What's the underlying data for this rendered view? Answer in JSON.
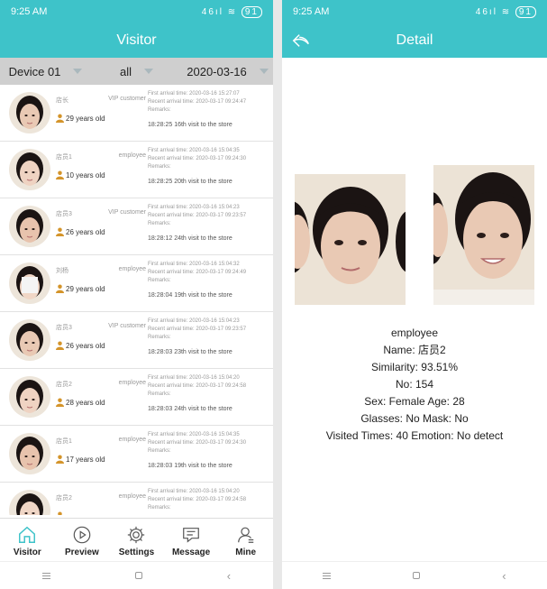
{
  "status": {
    "time": "9:25 AM",
    "signal": "46ıl",
    "battery": "91"
  },
  "left": {
    "title": "Visitor",
    "filters": {
      "device": "Device 01",
      "type": "all",
      "date": "2020-03-16"
    },
    "visitors": [
      {
        "name": "店长",
        "type": "VIP customer",
        "age": "29 years old",
        "first": "First arrival time: 2020-03-16 15:27:07",
        "recent": "Recent arrival time: 2020-03-17 09:24:47",
        "remarks": "Remarks:",
        "visit": "18:28:25 16th visit to the store"
      },
      {
        "name": "店员1",
        "type": "employee",
        "age": "10 years old",
        "first": "First arrival time: 2020-03-16 15:04:35",
        "recent": "Recent arrival time: 2020-03-17 09:24:30",
        "remarks": "Remarks:",
        "visit": "18:28:25 20th visit to the store"
      },
      {
        "name": "店员3",
        "type": "VIP customer",
        "age": "26 years old",
        "first": "First arrival time: 2020-03-16 15:04:23",
        "recent": "Recent arrival time: 2020-03-17 09:23:57",
        "remarks": "Remarks:",
        "visit": "18:28:12 24th visit to the store"
      },
      {
        "name": "刘杨",
        "type": "employee",
        "age": "29 years old",
        "first": "First arrival time: 2020-03-16 15:04:32",
        "recent": "Recent arrival time: 2020-03-17 09:24:49",
        "remarks": "Remarks:",
        "visit": "18:28:04 19th visit to the store"
      },
      {
        "name": "店员3",
        "type": "VIP customer",
        "age": "26 years old",
        "first": "First arrival time: 2020-03-16 15:04:23",
        "recent": "Recent arrival time: 2020-03-17 09:23:57",
        "remarks": "Remarks:",
        "visit": "18:28:03 23th visit to the store"
      },
      {
        "name": "店员2",
        "type": "employee",
        "age": "28 years old",
        "first": "First arrival time: 2020-03-16 15:04:20",
        "recent": "Recent arrival time: 2020-03-17 09:24:58",
        "remarks": "Remarks:",
        "visit": "18:28:03 24th visit to the store"
      },
      {
        "name": "店员1",
        "type": "employee",
        "age": "17 years old",
        "first": "First arrival time: 2020-03-16 15:04:35",
        "recent": "Recent arrival time: 2020-03-17 09:24:30",
        "remarks": "Remarks:",
        "visit": "18:28:03 19th visit to the store"
      },
      {
        "name": "店员2",
        "type": "employee",
        "age": "",
        "first": "First arrival time: 2020-03-16 15:04:20",
        "recent": "Recent arrival time: 2020-03-17 09:24:58",
        "remarks": "Remarks:",
        "visit": ""
      }
    ],
    "tabs": [
      "Visitor",
      "Preview",
      "Settings",
      "Message",
      "Mine"
    ]
  },
  "right": {
    "title": "Detail",
    "type": "employee",
    "name": "Name: 店员2",
    "similarity": "Similarity: 93.51%",
    "no": "No: 154",
    "sex_age": "Sex: Female  Age: 28",
    "glasses_mask": "Glasses: No  Mask: No",
    "visited_emotion": "Visited Times: 40  Emotion: No detect"
  },
  "colors": {
    "header": "#3ec3c9",
    "filter_bg": "#cfcfcf",
    "tab_active": "#3ec3c9",
    "skin": "#e9c9b4",
    "hair": "#1b1413",
    "avatar_person_icon": "#d4942a"
  }
}
